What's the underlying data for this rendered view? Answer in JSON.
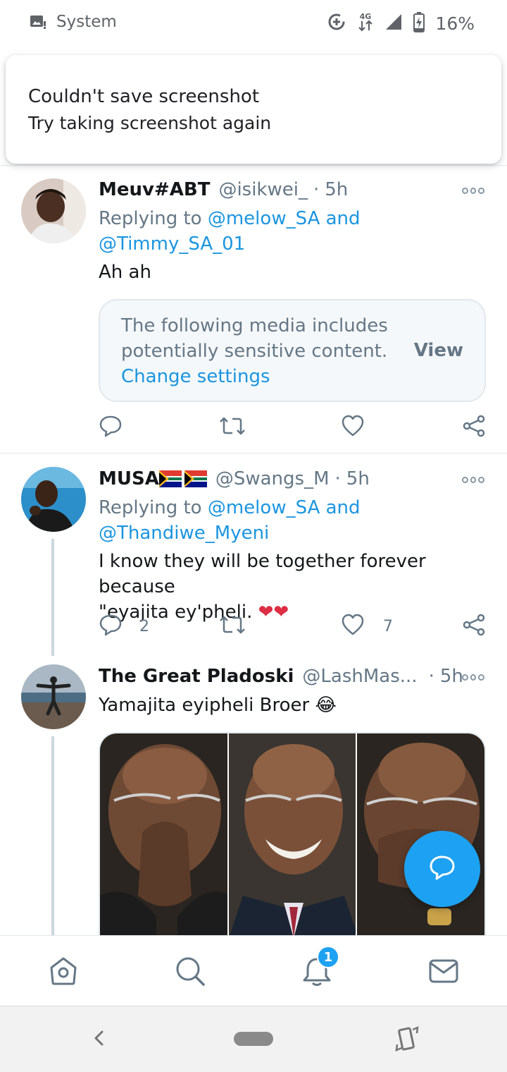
{
  "status_bar": {
    "app_label": "System",
    "network": "4G",
    "battery": "16%"
  },
  "toast": {
    "title": "Couldn't save screenshot",
    "body": "Try taking screenshot again"
  },
  "tweets": [
    {
      "name": "Meuv#ABT",
      "handle": "@isikwei_",
      "separator": "·",
      "time": "5h",
      "replying_prefix": "Replying to ",
      "replying_user1": "@melow_SA",
      "replying_and": " and",
      "replying_user2": "@Timmy_SA_01",
      "text": "Ah ah",
      "sensitive_line1": "The following media includes",
      "sensitive_line2": "potentially sensitive content.",
      "sensitive_link": "Change settings",
      "sensitive_view": "View",
      "replies": "",
      "likes": ""
    },
    {
      "name": "MUSA",
      "flag": "🇿🇦🇿🇦",
      "handle": "@Swangs_M",
      "separator": "·",
      "time": "5h",
      "replying_prefix": "Replying to ",
      "replying_user1": "@melow_SA",
      "replying_and": " and",
      "replying_user2": "@Thandiwe_Myeni",
      "text_line1": "I know they will be together forever because",
      "text_line2": "\"eyajita ey'pheli. ❤❤",
      "replies": "2",
      "likes": "7"
    },
    {
      "name": "The Great Pladoski",
      "handle": "@LashMas...",
      "separator": "·",
      "time": "5h",
      "text": "Yamajita eyipheli Broer 😂"
    }
  ],
  "tab_bar": {
    "notification_badge": "1"
  },
  "colors": {
    "accent": "#1da1f2",
    "link": "#1b95e0",
    "secondary_text": "#657786"
  }
}
